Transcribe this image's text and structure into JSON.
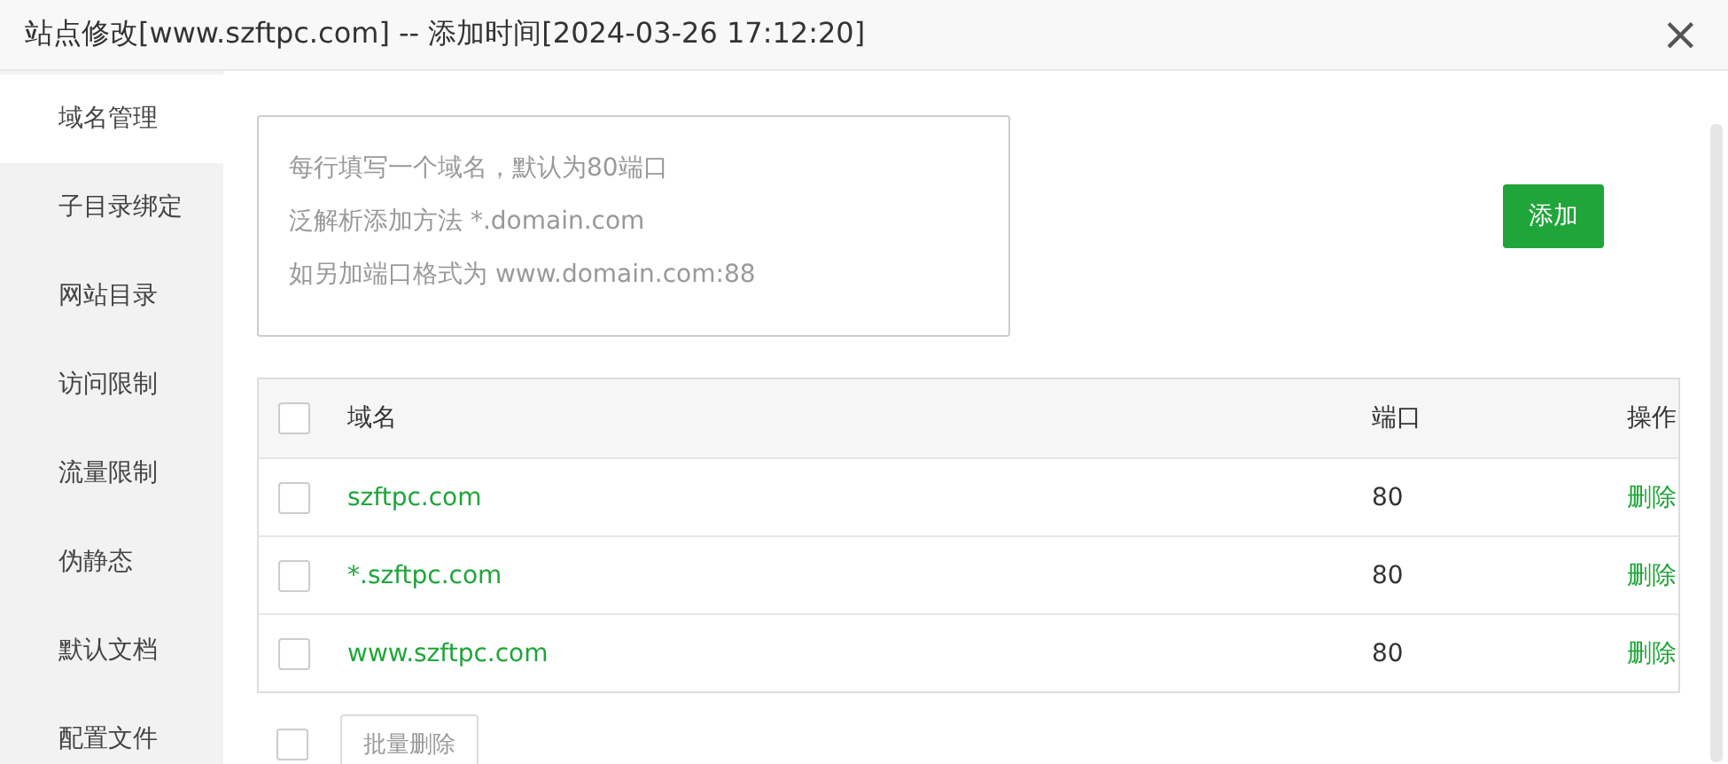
{
  "window": {
    "title": "站点修改[www.szftpc.com] -- 添加时间[2024-03-26 17:12:20]",
    "close": "×"
  },
  "sidebar": {
    "items": [
      {
        "label": "域名管理",
        "selected": true
      },
      {
        "label": "子目录绑定",
        "selected": false
      },
      {
        "label": "网站目录",
        "selected": false
      },
      {
        "label": "访问限制",
        "selected": false
      },
      {
        "label": "流量限制",
        "selected": false
      },
      {
        "label": "伪静态",
        "selected": false
      },
      {
        "label": "默认文档",
        "selected": false
      },
      {
        "label": "配置文件",
        "selected": false
      }
    ]
  },
  "domain_input": {
    "placeholder": [
      "每行填写一个域名，默认为80端口",
      "泛解析添加方法 *.domain.com",
      "如另加端口格式为 www.domain.com:88"
    ]
  },
  "add_button": "添加",
  "table": {
    "select_all_checked": false,
    "columns": [
      "域名",
      "端口",
      "操作"
    ],
    "rows": [
      {
        "checked": false,
        "domain": "szftpc.com",
        "port": "80",
        "action": "删除"
      },
      {
        "checked": false,
        "domain": "*.szftpc.com",
        "port": "80",
        "action": "删除"
      },
      {
        "checked": false,
        "domain": "www.szftpc.com",
        "port": "80",
        "action": "删除"
      }
    ]
  },
  "footer": {
    "checked": false,
    "batch_delete": "批量删除"
  }
}
